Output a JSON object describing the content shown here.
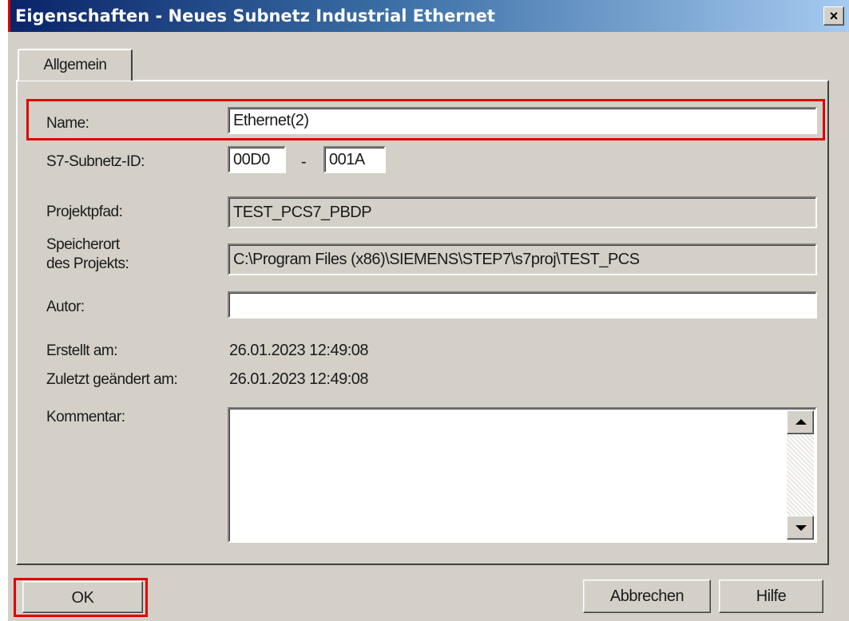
{
  "window": {
    "title": "Eigenschaften -  Neues Subnetz Industrial Ethernet",
    "close_symbol": "×"
  },
  "tabs": [
    {
      "label": "Allgemein",
      "selected": true
    }
  ],
  "form": {
    "name_label": "Name:",
    "name_value": "Ethernet(2)",
    "subnet_id_label": "S7-Subnetz-ID:",
    "subnet_id_part1": "00D0",
    "subnet_id_separator": "-",
    "subnet_id_part2": "001A",
    "project_path_label": "Projektpfad:",
    "project_path_value": "TEST_PCS7_PBDP",
    "storage_label_line1": "Speicherort",
    "storage_label_line2": "des Projekts:",
    "storage_value": "C:\\Program Files (x86)\\SIEMENS\\STEP7\\s7proj\\TEST_PCS",
    "author_label": "Autor:",
    "author_value": "",
    "created_label": "Erstellt am:",
    "created_value": "26.01.2023 12:49:08",
    "modified_label": "Zuletzt geändert am:",
    "modified_value": "26.01.2023 12:49:08",
    "comment_label": "Kommentar:",
    "comment_value": ""
  },
  "buttons": {
    "ok": "OK",
    "cancel": "Abbrechen",
    "help": "Hilfe"
  },
  "colors": {
    "dialog_bg": "#d4d0c8",
    "highlight_border": "#e00000",
    "title_gradient_start": "#0a246a",
    "title_gradient_end": "#a6caf0"
  }
}
